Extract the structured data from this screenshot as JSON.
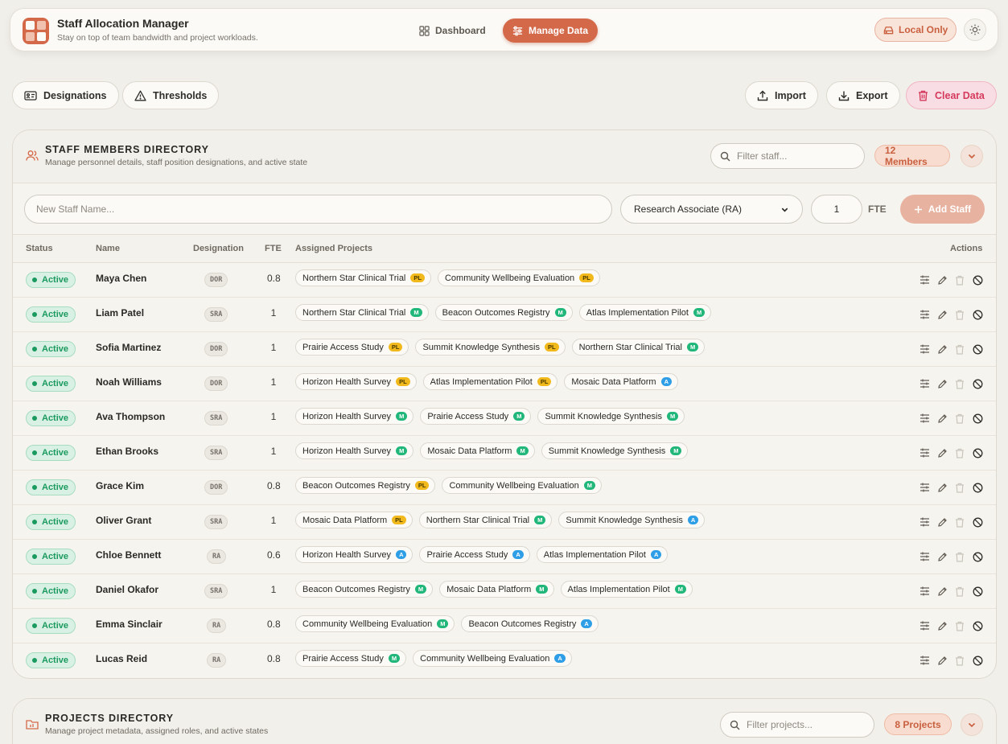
{
  "header": {
    "title": "Staff Allocation Manager",
    "subtitle": "Stay on top of team bandwidth and project workloads.",
    "nav": [
      {
        "label": "Dashboard",
        "icon": "grid-icon",
        "active": false
      },
      {
        "label": "Manage Data",
        "icon": "sliders-icon",
        "active": true
      }
    ],
    "local_only_label": "Local Only",
    "accent": "#d4694a"
  },
  "toolbar": {
    "designations_label": "Designations",
    "thresholds_label": "Thresholds",
    "import_label": "Import",
    "export_label": "Export",
    "clear_label": "Clear Data"
  },
  "staff_section": {
    "title": "STAFF MEMBERS DIRECTORY",
    "subtitle": "Manage personnel details, staff position designations, and active state",
    "filter_placeholder": "Filter staff...",
    "count_label": "12 Members",
    "new_name_placeholder": "New Staff Name...",
    "selected_designation": "Research Associate (RA)",
    "fte_value": "1",
    "fte_label": "FTE",
    "add_label": "Add Staff",
    "columns": {
      "status": "Status",
      "name": "Name",
      "designation": "Designation",
      "fte": "FTE",
      "projects": "Assigned Projects",
      "actions": "Actions"
    },
    "rows": [
      {
        "status": "Active",
        "name": "Maya Chen",
        "designation": "DOR",
        "fte": "0.8",
        "projects": [
          {
            "name": "Northern Star Clinical Trial",
            "role": "PL"
          },
          {
            "name": "Community Wellbeing Evaluation",
            "role": "PL"
          }
        ]
      },
      {
        "status": "Active",
        "name": "Liam Patel",
        "designation": "SRA",
        "fte": "1",
        "projects": [
          {
            "name": "Northern Star Clinical Trial",
            "role": "M"
          },
          {
            "name": "Beacon Outcomes Registry",
            "role": "M"
          },
          {
            "name": "Atlas Implementation Pilot",
            "role": "M"
          }
        ]
      },
      {
        "status": "Active",
        "name": "Sofia Martinez",
        "designation": "DOR",
        "fte": "1",
        "projects": [
          {
            "name": "Prairie Access Study",
            "role": "PL"
          },
          {
            "name": "Summit Knowledge Synthesis",
            "role": "PL"
          },
          {
            "name": "Northern Star Clinical Trial",
            "role": "M"
          }
        ]
      },
      {
        "status": "Active",
        "name": "Noah Williams",
        "designation": "DOR",
        "fte": "1",
        "projects": [
          {
            "name": "Horizon Health Survey",
            "role": "PL"
          },
          {
            "name": "Atlas Implementation Pilot",
            "role": "PL"
          },
          {
            "name": "Mosaic Data Platform",
            "role": "A"
          }
        ]
      },
      {
        "status": "Active",
        "name": "Ava Thompson",
        "designation": "SRA",
        "fte": "1",
        "projects": [
          {
            "name": "Horizon Health Survey",
            "role": "M"
          },
          {
            "name": "Prairie Access Study",
            "role": "M"
          },
          {
            "name": "Summit Knowledge Synthesis",
            "role": "M"
          }
        ]
      },
      {
        "status": "Active",
        "name": "Ethan Brooks",
        "designation": "SRA",
        "fte": "1",
        "projects": [
          {
            "name": "Horizon Health Survey",
            "role": "M"
          },
          {
            "name": "Mosaic Data Platform",
            "role": "M"
          },
          {
            "name": "Summit Knowledge Synthesis",
            "role": "M"
          }
        ]
      },
      {
        "status": "Active",
        "name": "Grace Kim",
        "designation": "DOR",
        "fte": "0.8",
        "projects": [
          {
            "name": "Beacon Outcomes Registry",
            "role": "PL"
          },
          {
            "name": "Community Wellbeing Evaluation",
            "role": "M"
          }
        ]
      },
      {
        "status": "Active",
        "name": "Oliver Grant",
        "designation": "SRA",
        "fte": "1",
        "projects": [
          {
            "name": "Mosaic Data Platform",
            "role": "PL"
          },
          {
            "name": "Northern Star Clinical Trial",
            "role": "M"
          },
          {
            "name": "Summit Knowledge Synthesis",
            "role": "A"
          }
        ]
      },
      {
        "status": "Active",
        "name": "Chloe Bennett",
        "designation": "RA",
        "fte": "0.6",
        "projects": [
          {
            "name": "Horizon Health Survey",
            "role": "A"
          },
          {
            "name": "Prairie Access Study",
            "role": "A"
          },
          {
            "name": "Atlas Implementation Pilot",
            "role": "A"
          }
        ]
      },
      {
        "status": "Active",
        "name": "Daniel Okafor",
        "designation": "SRA",
        "fte": "1",
        "projects": [
          {
            "name": "Beacon Outcomes Registry",
            "role": "M"
          },
          {
            "name": "Mosaic Data Platform",
            "role": "M"
          },
          {
            "name": "Atlas Implementation Pilot",
            "role": "M"
          }
        ]
      },
      {
        "status": "Active",
        "name": "Emma Sinclair",
        "designation": "RA",
        "fte": "0.8",
        "projects": [
          {
            "name": "Community Wellbeing Evaluation",
            "role": "M"
          },
          {
            "name": "Beacon Outcomes Registry",
            "role": "A"
          }
        ]
      },
      {
        "status": "Active",
        "name": "Lucas Reid",
        "designation": "RA",
        "fte": "0.8",
        "projects": [
          {
            "name": "Prairie Access Study",
            "role": "M"
          },
          {
            "name": "Community Wellbeing Evaluation",
            "role": "A"
          }
        ]
      }
    ]
  },
  "projects_section": {
    "title": "PROJECTS DIRECTORY",
    "subtitle": "Manage project metadata, assigned roles, and active states",
    "filter_placeholder": "Filter projects...",
    "count_label": "8 Projects"
  },
  "colors": {
    "role_PL": "#f2b91d",
    "role_M": "#22b77a",
    "role_A": "#2e9ee6",
    "active": "#1b9a5f",
    "danger": "#d43a5c"
  }
}
